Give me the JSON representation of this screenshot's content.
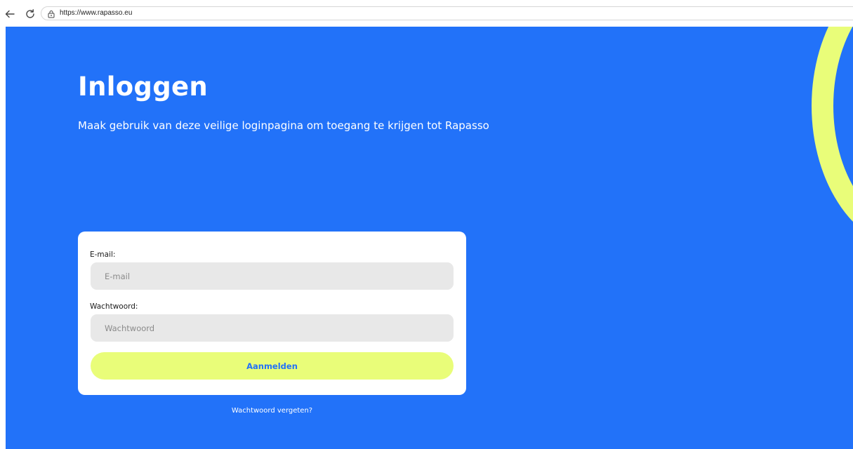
{
  "browser": {
    "url": "https://www.rapasso.eu"
  },
  "header": {
    "title": "Inloggen",
    "subtitle": "Maak gebruik van deze veilige loginpagina om toegang te krijgen tot Rapasso"
  },
  "login_form": {
    "email_label": "E-mail:",
    "email_placeholder": "E-mail",
    "email_value": "",
    "password_label": "Wachtwoord:",
    "password_placeholder": "Wachtwoord",
    "password_value": "",
    "submit_label": "Aanmelden",
    "forgot_password_label": "Wachtwoord vergeten?"
  },
  "colors": {
    "background": "#2272f9",
    "accent": "#e9fd79",
    "card": "#ffffff",
    "input_background": "#e8e8e8"
  },
  "icons": {
    "back": "arrow-left-icon",
    "reload": "reload-icon",
    "site_info": "site-info-icon",
    "decoration": "decorative-ring"
  }
}
